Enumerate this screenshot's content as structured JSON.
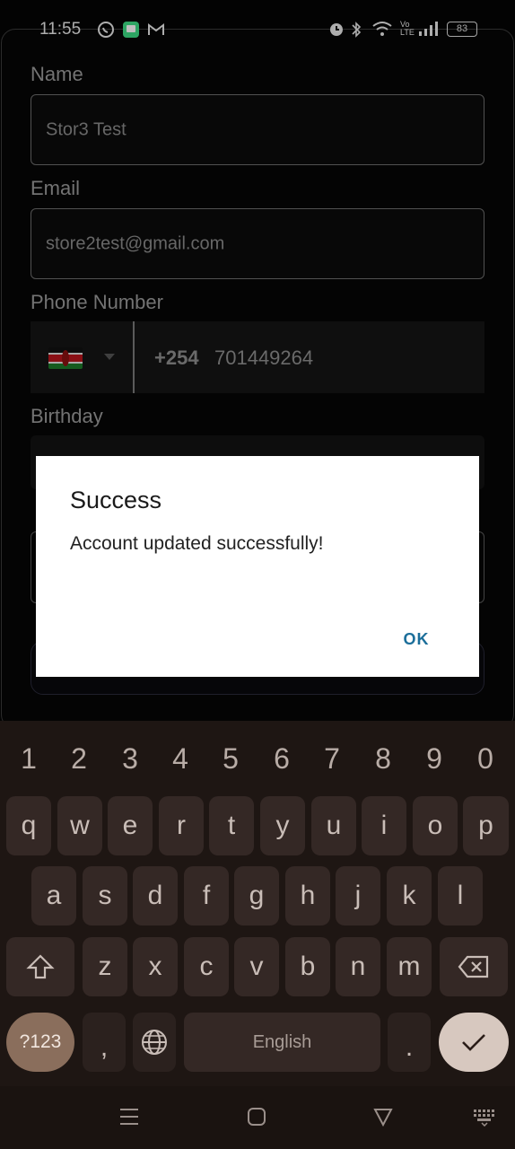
{
  "status_bar": {
    "time": "11:55",
    "battery": "83",
    "left_icons": [
      "whatsapp-icon",
      "messages-icon",
      "gmail-icon"
    ],
    "right_icons": [
      "alarm-icon",
      "bluetooth-icon",
      "wifi-icon",
      "volte-icon",
      "signal-icon"
    ]
  },
  "form": {
    "name": {
      "label": "Name",
      "value": "Stor3 Test"
    },
    "email": {
      "label": "Email",
      "value": "store2test@gmail.com"
    },
    "phone": {
      "label": "Phone Number",
      "dial_code": "+254",
      "number": "701449264",
      "country_flag": "kenya-flag-icon"
    },
    "birthday": {
      "label": "Birthday"
    }
  },
  "dialog": {
    "title": "Success",
    "message": "Account updated successfully!",
    "ok_label": "OK"
  },
  "keyboard": {
    "numbers": [
      "1",
      "2",
      "3",
      "4",
      "5",
      "6",
      "7",
      "8",
      "9",
      "0"
    ],
    "row1": [
      "q",
      "w",
      "e",
      "r",
      "t",
      "y",
      "u",
      "i",
      "o",
      "p"
    ],
    "row2": [
      "a",
      "s",
      "d",
      "f",
      "g",
      "h",
      "j",
      "k",
      "l"
    ],
    "row3": [
      "z",
      "x",
      "c",
      "v",
      "b",
      "n",
      "m"
    ],
    "sym_label": "?123",
    "comma": ",",
    "space_label": "English",
    "period": ".",
    "colors": {
      "background": "#1e1613",
      "key": "#342825",
      "sym": "#8a6e5c",
      "enter": "#d7c8bf"
    }
  },
  "colors": {
    "dialog_accent": "#1b6e9a"
  }
}
